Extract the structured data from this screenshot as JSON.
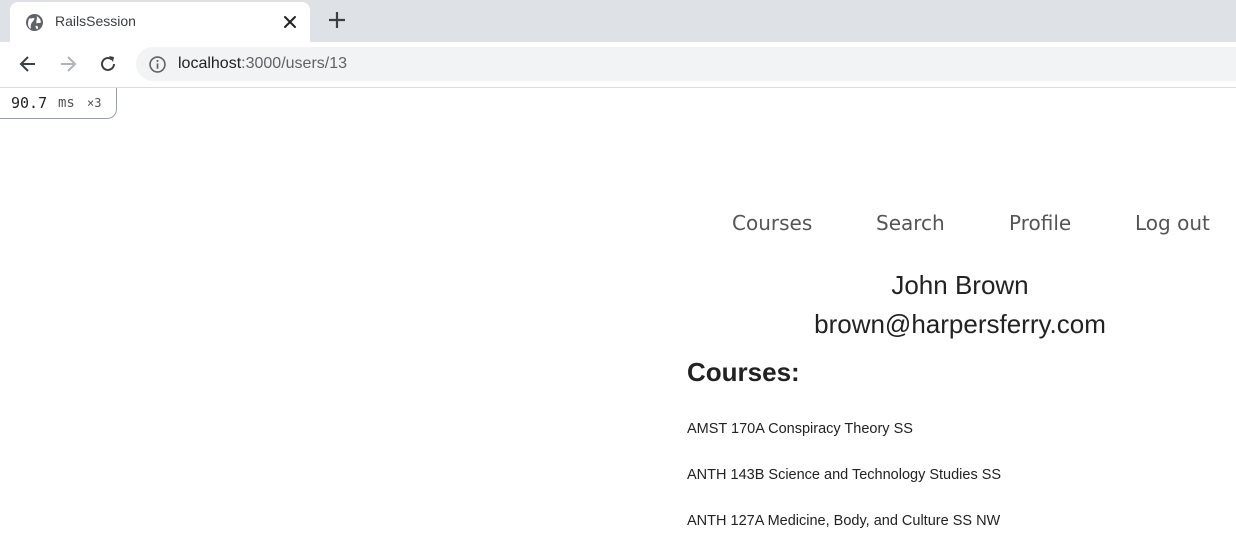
{
  "browser": {
    "tab_title": "RailsSession",
    "url_host": "localhost",
    "url_path": ":3000/users/13",
    "icons": {
      "favicon": "globe-icon",
      "close": "close-icon",
      "new_tab": "plus-icon",
      "back": "back-arrow-icon",
      "forward": "forward-arrow-icon",
      "reload": "reload-icon",
      "site_info": "info-icon"
    }
  },
  "perf_badge": {
    "value": "90.7",
    "unit": "ms",
    "count": "×3"
  },
  "nav": {
    "courses": "Courses",
    "search": "Search",
    "profile": "Profile",
    "logout": "Log out"
  },
  "user": {
    "name": "John Brown",
    "email": "brown@harpersferry.com"
  },
  "courses": {
    "heading": "Courses:",
    "items": [
      "AMST 170A Conspiracy Theory SS",
      "ANTH 143B Science and Technology Studies SS",
      "ANTH 127A Medicine, Body, and Culture SS NW"
    ]
  }
}
